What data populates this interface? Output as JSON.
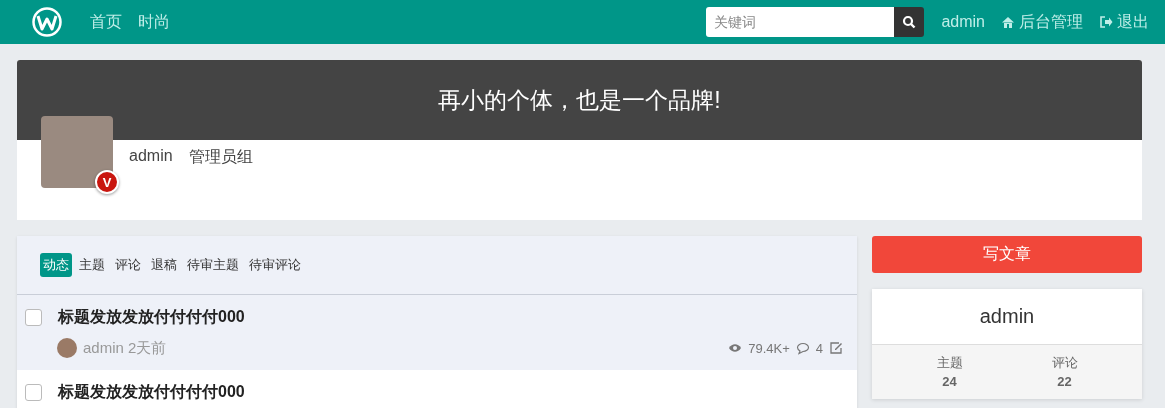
{
  "header": {
    "nav": [
      {
        "label": "首页"
      },
      {
        "label": "时尚"
      }
    ],
    "search": {
      "placeholder": "关键词"
    },
    "user": "admin",
    "admin_link": "后台管理",
    "logout": "退出"
  },
  "banner": {
    "slogan": "再小的个体，也是一个品牌!",
    "badge": "V",
    "username": "admin",
    "group": "管理员组"
  },
  "tabs": [
    {
      "label": "动态",
      "selected": true
    },
    {
      "label": "主题",
      "selected": false
    },
    {
      "label": "评论",
      "selected": false
    },
    {
      "label": "退稿",
      "selected": false
    },
    {
      "label": "待审主题",
      "selected": false
    },
    {
      "label": "待审评论",
      "selected": false
    }
  ],
  "threads": [
    {
      "title": "标题发放发放付付付付000",
      "checked": false,
      "highlighted": true,
      "author": "admin",
      "time": "2天前",
      "views": "79.4K+",
      "comments": "4"
    },
    {
      "title": "标题发放发放付付付付000",
      "checked": false,
      "highlighted": false
    }
  ],
  "sidebar": {
    "write_button": "写文章",
    "username": "admin",
    "stats": [
      {
        "label": "主题",
        "value": "24"
      },
      {
        "label": "评论",
        "value": "22"
      }
    ]
  }
}
